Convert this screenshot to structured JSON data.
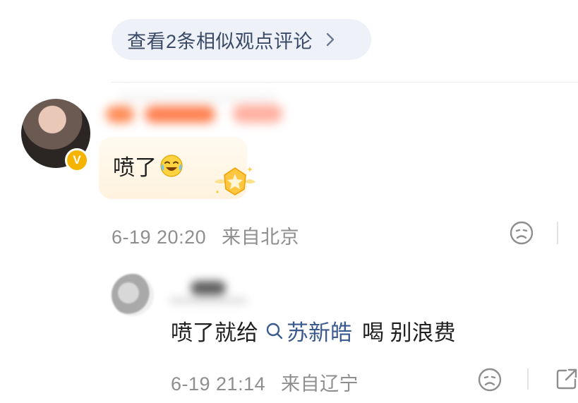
{
  "similar": {
    "label": "查看2条相似观点评论",
    "icon": "chevron-right-icon"
  },
  "comment": {
    "text": "喷了",
    "emoji": "laugh-cry-emoji",
    "time": "6-19 20:20",
    "location": "来自北京",
    "badge": "V",
    "badge_color": "#f5b400"
  },
  "reply": {
    "prefix": "喷了就给",
    "search_term": "苏新皓",
    "suffix": "喝 别浪费",
    "time": "6-19 21:14",
    "location": "来自辽宁",
    "link_color": "#3b5b8f"
  }
}
